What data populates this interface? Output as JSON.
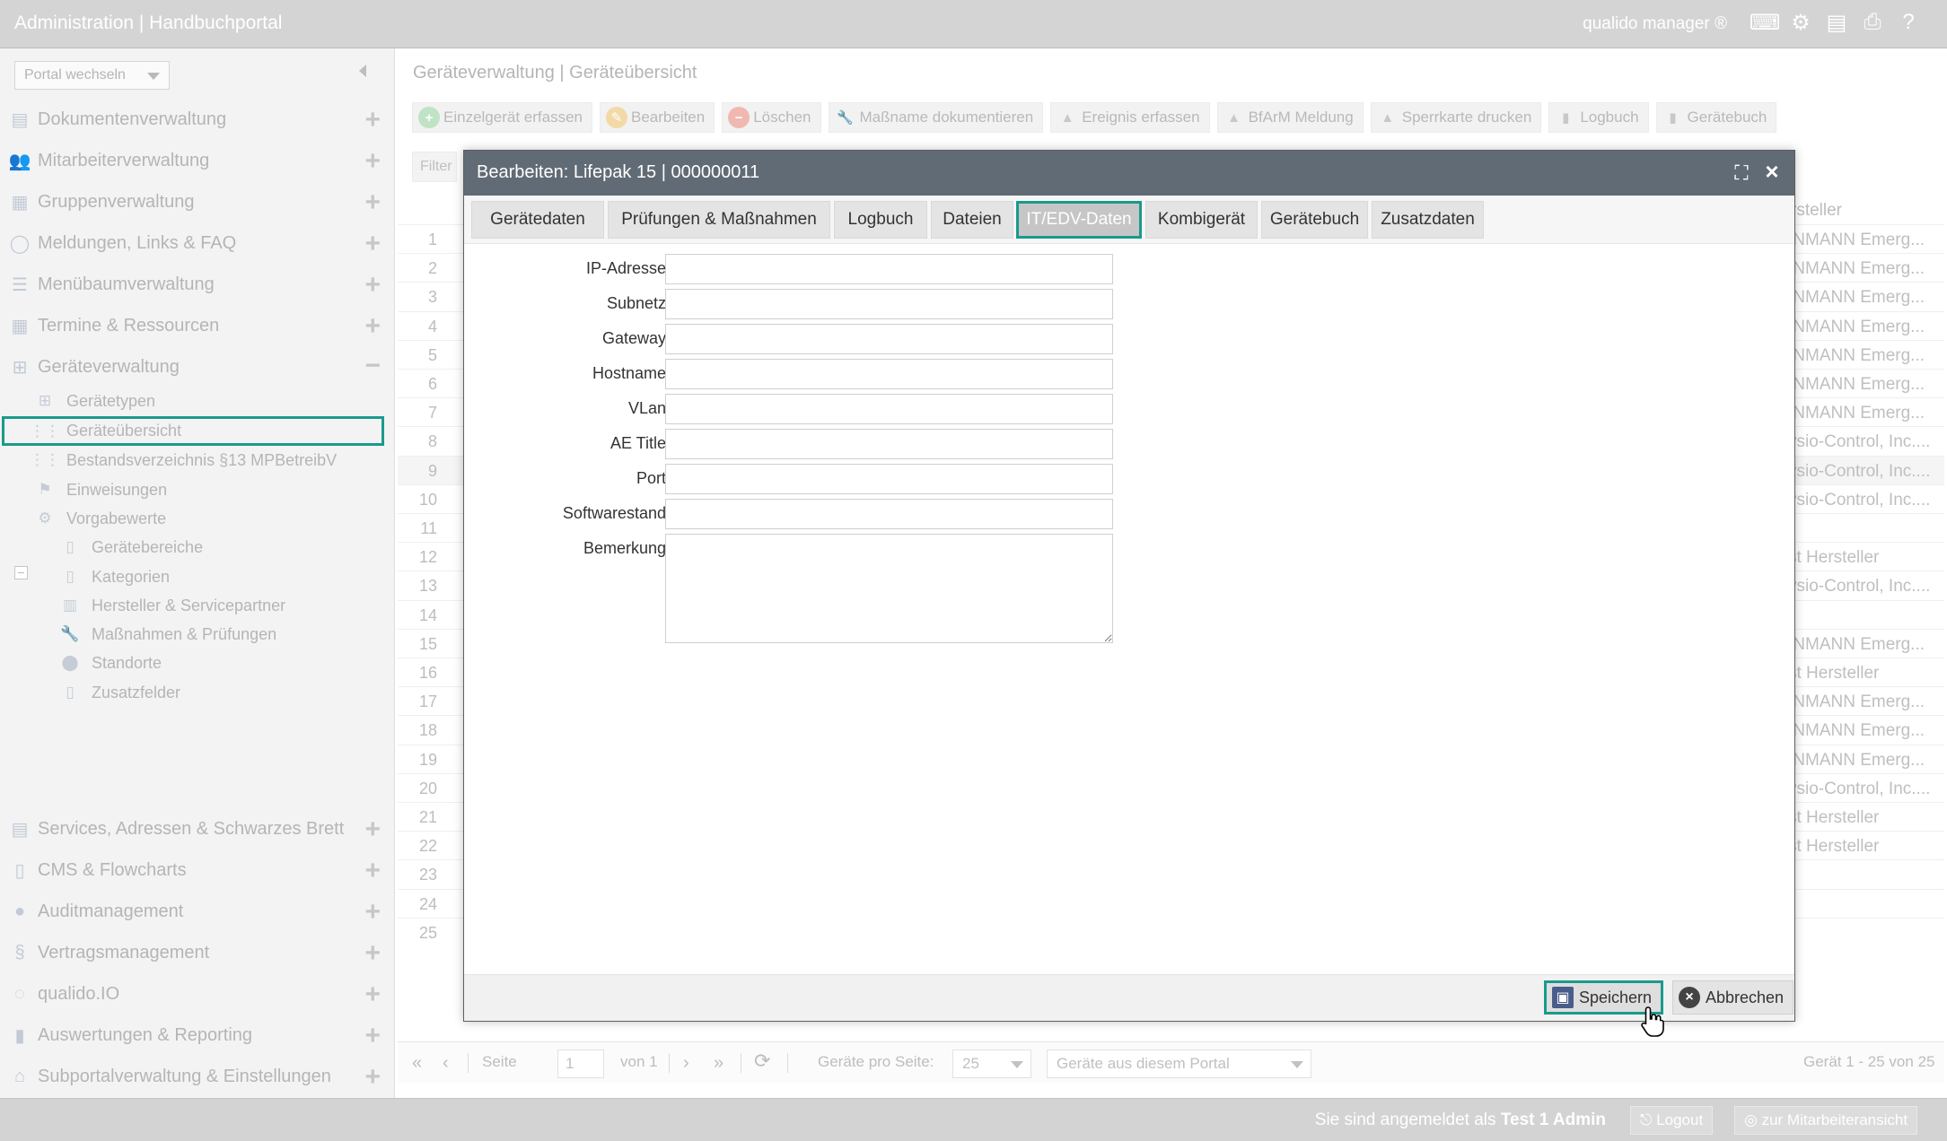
{
  "topbar": {
    "title": "Administration | Handbuchportal",
    "brand": "qualido manager ®",
    "icons": [
      "keyboard-icon",
      "network-icon",
      "document-icon",
      "print-icon",
      "help-icon"
    ]
  },
  "sidebar": {
    "portal_select": "Portal wechseln",
    "items": [
      {
        "label": "Dokumentenverwaltung",
        "icon": "document-icon"
      },
      {
        "label": "Mitarbeiterverwaltung",
        "icon": "users-icon"
      },
      {
        "label": "Gruppenverwaltung",
        "icon": "group-icon"
      },
      {
        "label": "Meldungen, Links & FAQ",
        "icon": "chat-icon"
      },
      {
        "label": "Menübaumverwaltung",
        "icon": "list-icon"
      },
      {
        "label": "Termine & Ressourcen",
        "icon": "calendar-icon"
      },
      {
        "label": "Geräteverwaltung",
        "icon": "device-icon"
      }
    ],
    "sub_items": [
      {
        "label": "Gerätetypen"
      },
      {
        "label": "Geräteübersicht"
      },
      {
        "label": "Bestandsverzeichnis §13 MPBetreibV"
      },
      {
        "label": "Einweisungen"
      },
      {
        "label": "Vorgabewerte"
      },
      {
        "label": "Gerätebereiche"
      },
      {
        "label": "Kategorien"
      },
      {
        "label": "Hersteller & Servicepartner"
      },
      {
        "label": "Maßnahmen & Prüfungen"
      },
      {
        "label": "Standorte"
      },
      {
        "label": "Zusatzfelder"
      }
    ],
    "bottom_items": [
      {
        "label": "Services, Adressen & Schwarzes Brett"
      },
      {
        "label": "CMS & Flowcharts"
      },
      {
        "label": "Auditmanagement"
      },
      {
        "label": "Vertragsmanagement"
      },
      {
        "label": "qualido.IO"
      },
      {
        "label": "Auswertungen & Reporting"
      },
      {
        "label": "Subportalverwaltung & Einstellungen"
      }
    ]
  },
  "main": {
    "breadcrumb": "Geräteverwaltung | Geräteübersicht",
    "toolbar": [
      {
        "label": "Einzelgerät erfassen",
        "icon": "plus-circle-icon",
        "color": "#bfe3c4"
      },
      {
        "label": "Bearbeiten",
        "icon": "edit-icon",
        "color": "#f3d9a6"
      },
      {
        "label": "Löschen",
        "icon": "minus-circle-icon",
        "color": "#f0b8b0"
      },
      {
        "label": "Maßname dokumentieren",
        "icon": "wrench-icon",
        "color": "#c8c8c8"
      },
      {
        "label": "Ereignis erfassen",
        "icon": "warning-icon",
        "color": "#c8c8c8"
      },
      {
        "label": "BfArM Meldung",
        "icon": "warning-icon",
        "color": "#c8c8c8"
      },
      {
        "label": "Sperrkarte drucken",
        "icon": "warning-icon",
        "color": "#c8c8c8"
      },
      {
        "label": "Logbuch",
        "icon": "book-icon",
        "color": "#c8c8c8"
      },
      {
        "label": "Gerätebuch",
        "icon": "book-icon",
        "color": "#c8c8c8"
      }
    ],
    "filter": "Filter",
    "grid_header_partial": "rsteller",
    "rows": [
      {
        "n": "1",
        "mfr": "INMANN Emerg..."
      },
      {
        "n": "2",
        "mfr": "INMANN Emerg..."
      },
      {
        "n": "3",
        "mfr": "INMANN Emerg..."
      },
      {
        "n": "4",
        "mfr": "INMANN Emerg..."
      },
      {
        "n": "5",
        "mfr": "INMANN Emerg..."
      },
      {
        "n": "6",
        "mfr": "INMANN Emerg..."
      },
      {
        "n": "7",
        "mfr": "INMANN Emerg..."
      },
      {
        "n": "8",
        "mfr": "ysio-Control, Inc...."
      },
      {
        "n": "9",
        "mfr": "ysio-Control, Inc...."
      },
      {
        "n": "10",
        "mfr": "ysio-Control, Inc...."
      },
      {
        "n": "11",
        "mfr": ""
      },
      {
        "n": "12",
        "mfr": "st Hersteller"
      },
      {
        "n": "13",
        "mfr": "ysio-Control, Inc...."
      },
      {
        "n": "14",
        "mfr": ""
      },
      {
        "n": "15",
        "mfr": "INMANN Emerg..."
      },
      {
        "n": "16",
        "mfr": "st Hersteller"
      },
      {
        "n": "17",
        "mfr": "INMANN Emerg..."
      },
      {
        "n": "18",
        "mfr": "INMANN Emerg..."
      },
      {
        "n": "19",
        "mfr": "INMANN Emerg..."
      },
      {
        "n": "20",
        "mfr": "ysio-Control, Inc...."
      },
      {
        "n": "21",
        "mfr": "st Hersteller"
      },
      {
        "n": "22",
        "mfr": "st Hersteller"
      },
      {
        "n": "23",
        "mfr": ""
      },
      {
        "n": "24",
        "mfr": ""
      },
      {
        "n": "25",
        "mfr": ""
      }
    ],
    "pager": {
      "page_label": "Seite",
      "page_value": "1",
      "of_label": "von 1",
      "per_page_label": "Geräte pro Seite:",
      "per_page_value": "25",
      "portal_filter": "Geräte aus diesem Portal",
      "summary": "Gerät 1 - 25 von 25"
    }
  },
  "modal": {
    "title": "Bearbeiten: Lifepak 15 | 000000011",
    "tabs": [
      {
        "label": "Gerätedaten"
      },
      {
        "label": "Prüfungen & Maßnahmen"
      },
      {
        "label": "Logbuch"
      },
      {
        "label": "Dateien"
      },
      {
        "label": "IT/EDV-Daten",
        "active": true
      },
      {
        "label": "Kombigerät"
      },
      {
        "label": "Gerätebuch"
      },
      {
        "label": "Zusatzdaten"
      }
    ],
    "fields": [
      {
        "label": "IP-Adresse:",
        "value": ""
      },
      {
        "label": "Subnetz:",
        "value": ""
      },
      {
        "label": "Gateway:",
        "value": ""
      },
      {
        "label": "Hostname:",
        "value": ""
      },
      {
        "label": "VLan:",
        "value": ""
      },
      {
        "label": "AE Title:",
        "value": ""
      },
      {
        "label": "Port:",
        "value": ""
      },
      {
        "label": "Softwarestand:",
        "value": ""
      }
    ],
    "remark": {
      "label": "Bemerkung:",
      "value": ""
    },
    "save_label": "Speichern",
    "cancel_label": "Abbrechen"
  },
  "statusbar": {
    "logged_in_prefix": "Sie sind angemeldet als",
    "user": "Test 1 Admin",
    "logout": "Logout",
    "employee_view": "zur Mitarbeiteransicht"
  },
  "colors": {
    "accent": "#1a9a8c",
    "modal_header": "#616b75"
  }
}
